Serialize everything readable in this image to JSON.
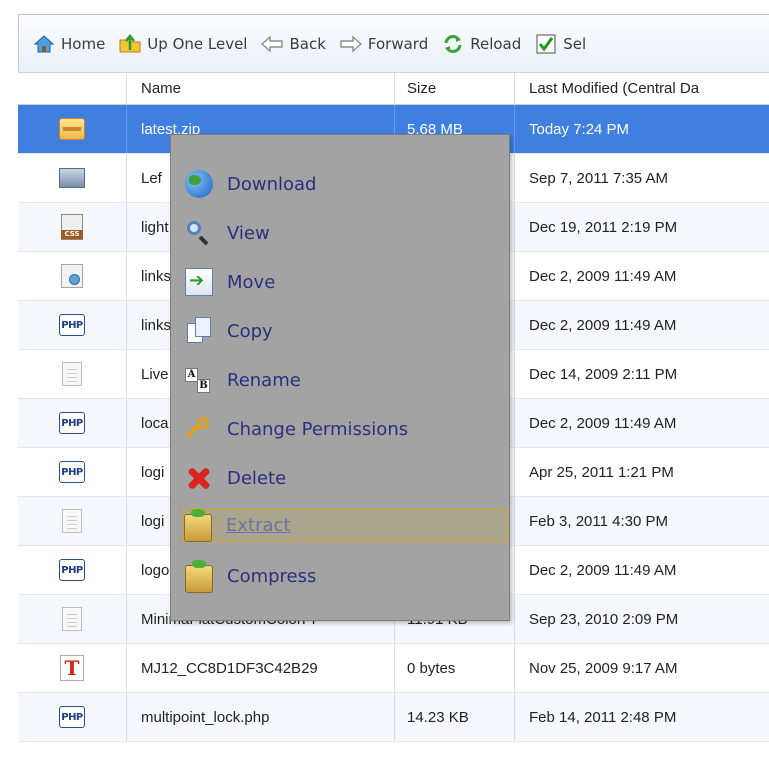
{
  "toolbar": {
    "items": [
      {
        "label": "Home",
        "icon": "home-icon"
      },
      {
        "label": "Up One Level",
        "icon": "up-level-icon"
      },
      {
        "label": "Back",
        "icon": "back-arrow-icon"
      },
      {
        "label": "Forward",
        "icon": "forward-arrow-icon"
      },
      {
        "label": "Reload",
        "icon": "reload-icon"
      },
      {
        "label": "Sel",
        "icon": "checkbox-icon"
      }
    ]
  },
  "table": {
    "columns": [
      "",
      "Name",
      "Size",
      "Last Modified (Central Da"
    ],
    "rows": [
      {
        "icon": "zip-file-icon",
        "name": "latest.zip",
        "size": "5.68 MB",
        "modified": "Today 7:24 PM",
        "selected": true
      },
      {
        "icon": "image-file-icon",
        "name": "Lef",
        "size": "",
        "modified": "Sep 7, 2011 7:35 AM"
      },
      {
        "icon": "css-file-icon",
        "name": "light",
        "size": "",
        "modified": "Dec 19, 2011 2:19 PM"
      },
      {
        "icon": "link-file-icon",
        "name": "links",
        "size": "",
        "modified": "Dec 2, 2009 11:49 AM"
      },
      {
        "icon": "php-file-icon",
        "name": "links",
        "size": "",
        "modified": "Dec 2, 2009 11:49 AM"
      },
      {
        "icon": "text-file-icon",
        "name": "Live",
        "size": "",
        "modified": "Dec 14, 2009 2:11 PM"
      },
      {
        "icon": "php-file-icon",
        "name": "loca",
        "size": "",
        "modified": "Dec 2, 2009 11:49 AM"
      },
      {
        "icon": "php-file-icon",
        "name": "logi",
        "size": "",
        "modified": "Apr 25, 2011 1:21 PM"
      },
      {
        "icon": "text-file-icon",
        "name": "logi",
        "size": "",
        "modified": "Feb 3, 2011 4:30 PM"
      },
      {
        "icon": "php-file-icon",
        "name": "logo",
        "size": "",
        "modified": "Dec 2, 2009 11:49 AM"
      },
      {
        "icon": "text-file-icon",
        "name": "MinimaFlatCustomColorPl",
        "size": "11.91 KB",
        "modified": "Sep 23, 2010 2:09 PM"
      },
      {
        "icon": "font-file-icon",
        "name": "MJ12_CC8D1DF3C42B29",
        "size": "0 bytes",
        "modified": "Nov 25, 2009 9:17 AM"
      },
      {
        "icon": "php-file-icon",
        "name": "multipoint_lock.php",
        "size": "14.23 KB",
        "modified": "Feb 14, 2011 2:48 PM"
      }
    ]
  },
  "context_menu": {
    "items": [
      {
        "label": "Download",
        "icon": "download-globe-icon"
      },
      {
        "label": "View",
        "icon": "magnifier-icon"
      },
      {
        "label": "Move",
        "icon": "move-icon"
      },
      {
        "label": "Copy",
        "icon": "copy-icon"
      },
      {
        "label": "Rename",
        "icon": "rename-icon"
      },
      {
        "label": "Change Permissions",
        "icon": "key-icon"
      },
      {
        "label": "Delete",
        "icon": "delete-x-icon"
      },
      {
        "label": "Extract",
        "icon": "extract-box-icon",
        "state": "hover-disabled"
      },
      {
        "label": "Compress",
        "icon": "compress-box-icon"
      }
    ]
  }
}
